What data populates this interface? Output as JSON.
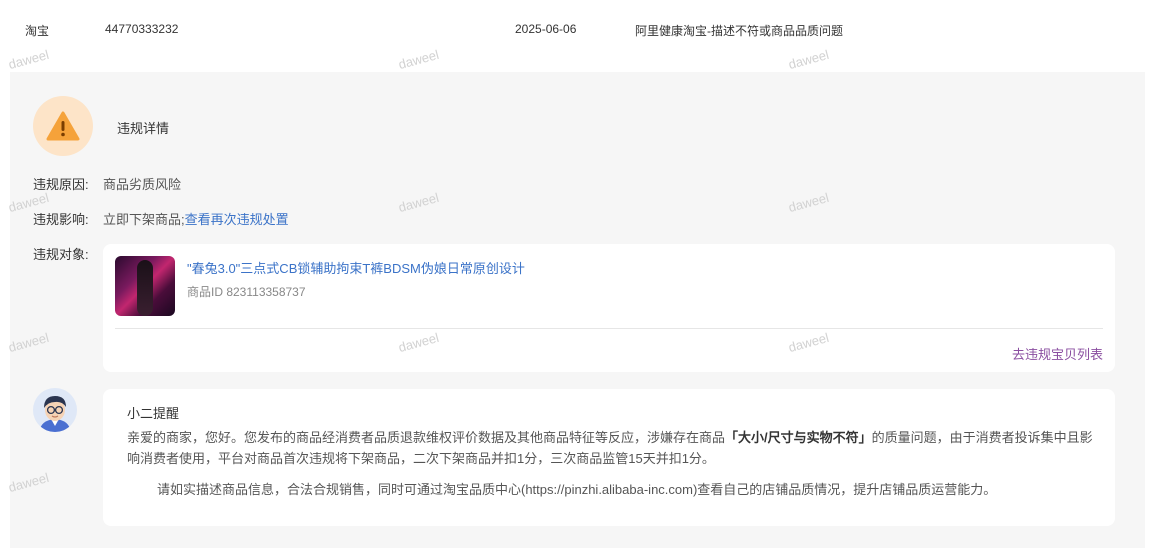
{
  "record": {
    "platform": "淘宝",
    "record_id": "44770333232",
    "date": "2025-06-06",
    "source": "阿里健康淘宝-描述不符或商品品质问题"
  },
  "violation": {
    "title": "违规详情",
    "reason_label": "违规原因:",
    "reason_value": "商品劣质风险",
    "impact_label": "违规影响:",
    "impact_value": "立即下架商品;",
    "impact_link": "查看再次违规处置",
    "target_label": "违规对象:"
  },
  "product": {
    "name": "\"春兔3.0\"三点式CB锁辅助拘束T裤BDSM伪娘日常原创设计",
    "id_text": "商品ID 823113358737",
    "list_link": "去违规宝贝列表"
  },
  "notice": {
    "title": "小二提醒",
    "para1_before": "亲爱的商家，您好。您发布的商品经消费者品质退款维权评价数据及其他商品特征等反应，涉嫌存在商品",
    "para1_bold": "「大小/尺寸与实物不符」",
    "para1_after": "的质量问题，由于消费者投诉集中且影响消费者使用，平台对商品首次违规将下架商品，二次下架商品并扣1分，三次商品监管15天并扣1分。",
    "para2": "请如实描述商品信息，合法合规销售，同时可通过淘宝品质中心(https://pinzhi.alibaba-inc.com)查看自己的店铺品质情况，提升店铺品质运营能力。"
  },
  "watermark": "daweel",
  "colors": {
    "link": "#3b73c8",
    "list_link": "#8a4ea0",
    "warning": "#f5a23a",
    "panel_bg": "#f6f6f6"
  },
  "icons": {
    "warning": "warning-triangle-icon",
    "avatar": "assistant-avatar-icon"
  }
}
